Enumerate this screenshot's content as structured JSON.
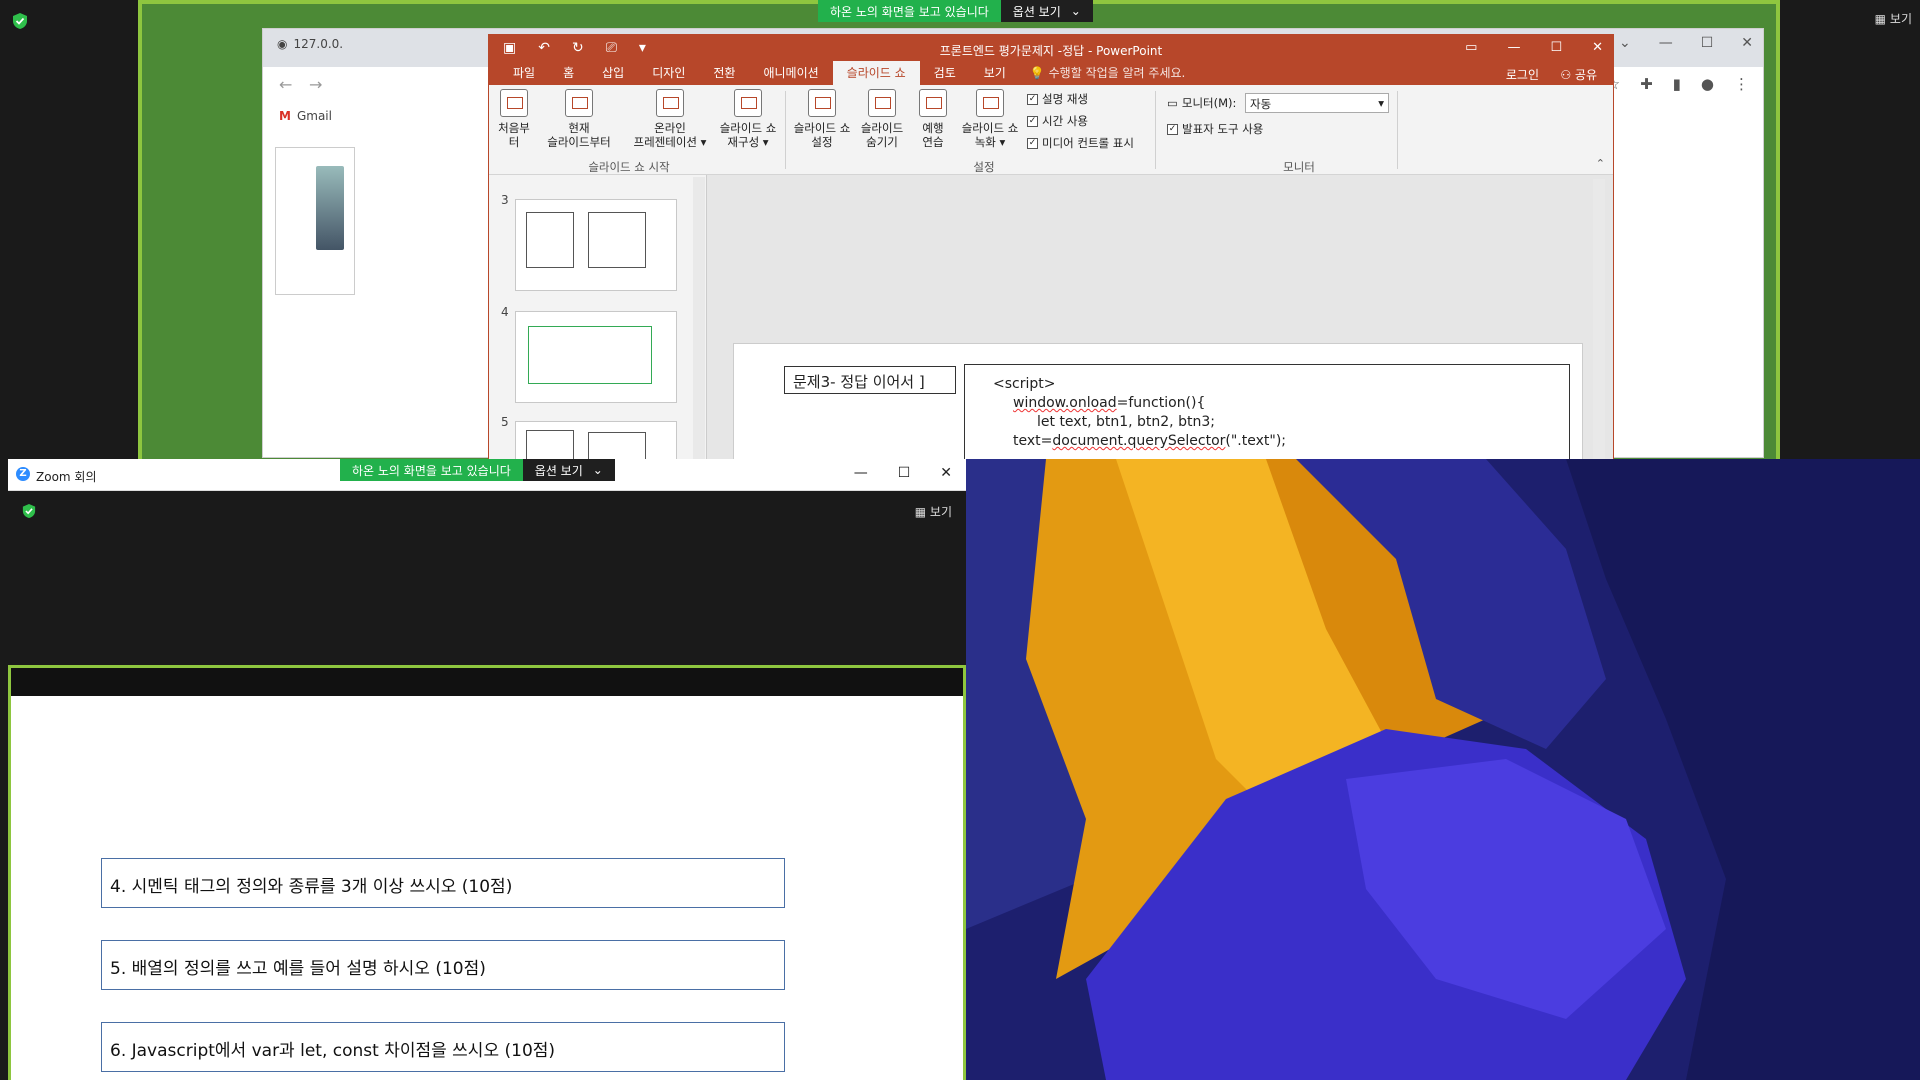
{
  "top_share": {
    "banner_text": "하온 노의 화면을 보고 있습니다",
    "banner_options": "옵션 보기",
    "view_label": "보기"
  },
  "chrome": {
    "tab_title": "127.0.0.",
    "bookmark_label": "Gmail"
  },
  "powerpoint": {
    "window_title": "프론트엔드 평가문제지 -정답 - PowerPoint",
    "menu_tabs": [
      "파일",
      "홈",
      "삽입",
      "디자인",
      "전환",
      "애니메이션",
      "슬라이드 쇼",
      "검토",
      "보기"
    ],
    "active_tab": "슬라이드 쇼",
    "tell_me": "수행할 작업을 알려 주세요.",
    "login": "로그인",
    "share": "공유",
    "ribbon": {
      "from_start": "처음부터",
      "from_current_l1": "현재",
      "from_current_l2": "슬라이드부터",
      "online_l1": "온라인",
      "online_l2": "프레젠테이션 ▾",
      "custom_l1": "슬라이드 쇼",
      "custom_l2": "재구성 ▾",
      "group_start": "슬라이드 쇼 시작",
      "setup_l1": "슬라이드 쇼",
      "setup_l2": "설정",
      "hide_l1": "슬라이드",
      "hide_l2": "숨기기",
      "rehearse_l1": "예행",
      "rehearse_l2": "연습",
      "record_l1": "슬라이드 쇼",
      "record_l2": "녹화 ▾",
      "chk_narration": "설명 재생",
      "chk_timing": "시간 사용",
      "chk_media": "미디어 컨트롤 표시",
      "group_setup": "설정",
      "monitor_label": "모니터(M):",
      "monitor_value": "자동",
      "chk_presenter": "발표자 도구 사용",
      "group_monitor": "모니터"
    },
    "thumb_numbers": [
      "3",
      "4",
      "5"
    ],
    "slide": {
      "label": "문제3- 정답 이어서 ]",
      "code_line1": "<script>",
      "code_line2": "window.onload",
      "code_line2b": "=function(){",
      "code_line3": "let text, btn1, btn2, btn3;",
      "code_line4a": "text=",
      "code_line4b": "document.querySelector",
      "code_line4c": "(\".text\");"
    }
  },
  "zoom_window": {
    "title": "Zoom 회의",
    "banner_text": "하온 노의 화면을 보고 있습니다",
    "banner_options": "옵션 보기",
    "view_label": "보기",
    "questions": [
      "4. 시멘틱 태그의 정의와 종류를 3개 이상 쓰시오 (10점)",
      "5. 배열의 정의를 쓰고 예를 들어 설명 하시오 (10점)",
      "6. Javascript에서 var과 let, const 차이점을 쓰시오 (10점)"
    ]
  },
  "colors": {
    "ppt_accent": "#b7472a",
    "zoom_green": "#22b14c",
    "share_border": "#8ec63f"
  }
}
